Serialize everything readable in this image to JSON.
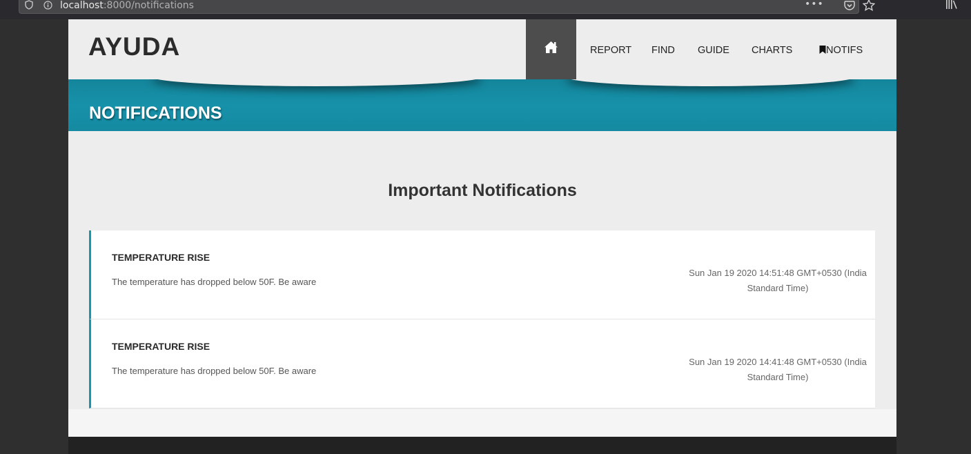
{
  "browser": {
    "url_host": "localhost",
    "url_path": ":8000/notifications",
    "menu_dots": "•••"
  },
  "header": {
    "logo": "AYUDA",
    "nav": [
      {
        "label": "REPORT"
      },
      {
        "label": "FIND"
      },
      {
        "label": "GUIDE"
      },
      {
        "label": "CHARTS"
      },
      {
        "label": "NOTIFS",
        "icon": "bookmark-icon"
      }
    ]
  },
  "banner": {
    "title": "NOTIFICATIONS"
  },
  "main": {
    "heading": "Important Notifications",
    "notifications": [
      {
        "title": "TEMPERATURE RISE",
        "message": "The temperature has dropped below 50F. Be aware",
        "time_line1": "Sun Jan 19 2020 14:51:48 GMT+0530 (India",
        "time_line2": "Standard Time)"
      },
      {
        "title": "TEMPERATURE RISE",
        "message": "The temperature has dropped below 50F. Be aware",
        "time_line1": "Sun Jan 19 2020 14:41:48 GMT+0530 (India",
        "time_line2": "Standard Time)"
      }
    ]
  },
  "colors": {
    "accent": "#1691a9",
    "nav_active": "#4d4d4d",
    "page_bg": "#ededed"
  }
}
